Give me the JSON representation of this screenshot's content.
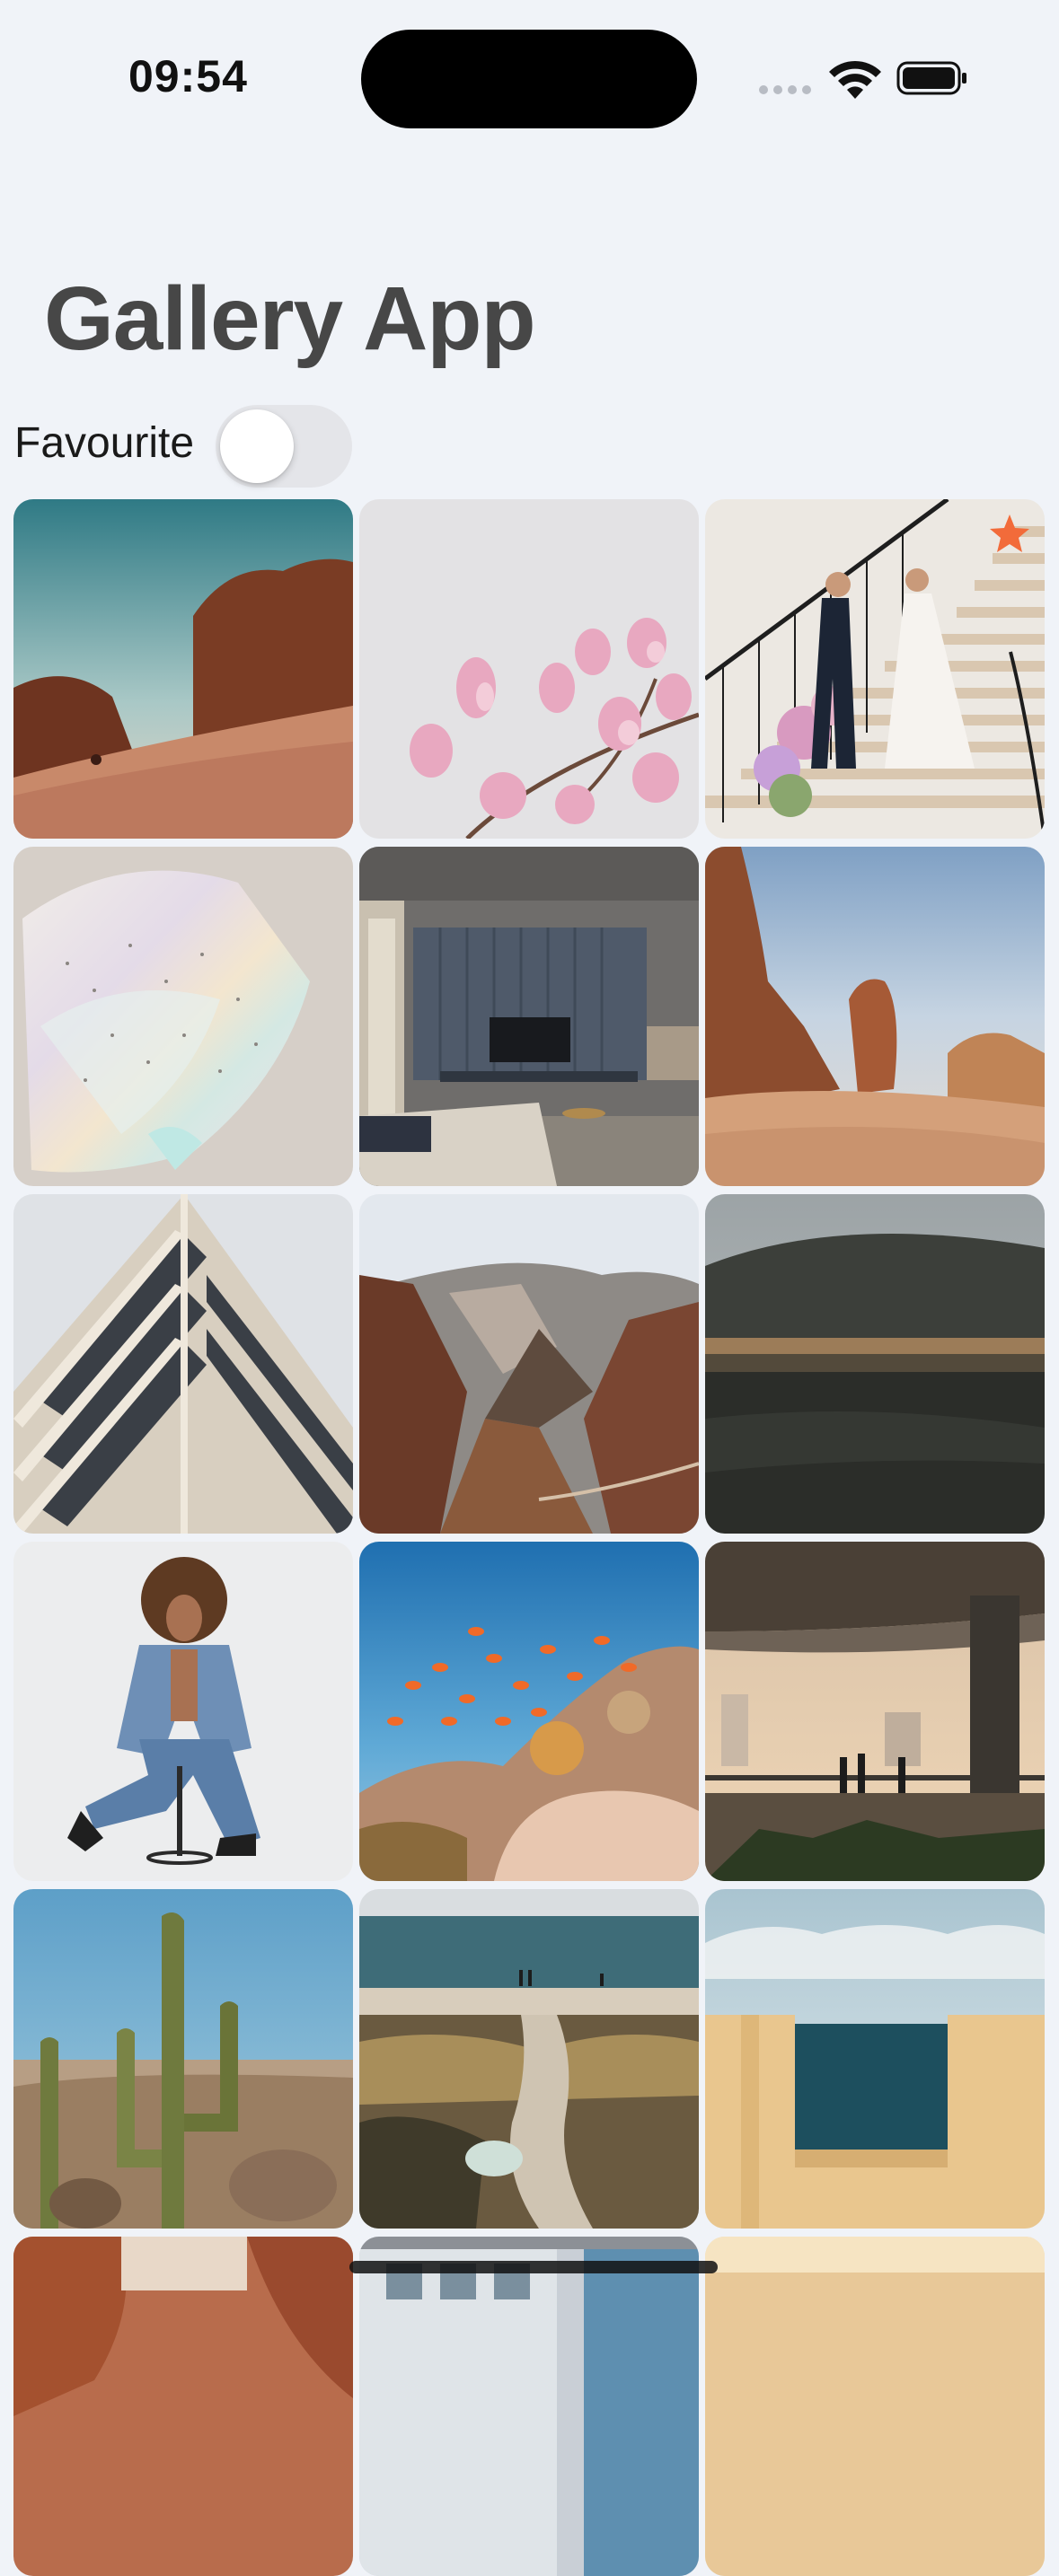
{
  "status_bar": {
    "time": "09:54",
    "icons": [
      "cellular-signal-icon",
      "wifi-icon",
      "battery-icon"
    ]
  },
  "header": {
    "title": "Gallery App"
  },
  "filter": {
    "favourite_label": "Favourite",
    "favourite_on": false
  },
  "colors": {
    "background": "#f0f3f8",
    "title": "#474747",
    "toggle_off": "#e4e5e9",
    "favourite_star": "#f26b3a"
  },
  "photos": [
    {
      "subject": "desert-dune-rock-formations",
      "favourite": false
    },
    {
      "subject": "pink-magnolia-blossoms",
      "favourite": false
    },
    {
      "subject": "wedding-couple-on-staircase",
      "favourite": true
    },
    {
      "subject": "iridescent-plastic-sheet",
      "favourite": false
    },
    {
      "subject": "modern-living-room-interior",
      "favourite": false
    },
    {
      "subject": "desert-rock-pillars",
      "favourite": false
    },
    {
      "subject": "modern-building-facade",
      "favourite": false
    },
    {
      "subject": "canyon-mountains",
      "favourite": false
    },
    {
      "subject": "lake-reflection",
      "favourite": false
    },
    {
      "subject": "woman-in-denim-on-stool",
      "favourite": false
    },
    {
      "subject": "coral-reef-with-fish",
      "favourite": false
    },
    {
      "subject": "bridge-at-sunset",
      "favourite": false
    },
    {
      "subject": "cactus-desert",
      "favourite": false
    },
    {
      "subject": "beach-dune-path",
      "favourite": false
    },
    {
      "subject": "sea-view-through-wall",
      "favourite": false
    },
    {
      "subject": "red-rock-partial",
      "favourite": false
    },
    {
      "subject": "building-partial",
      "favourite": false
    },
    {
      "subject": "sand-wall-partial",
      "favourite": false
    }
  ]
}
